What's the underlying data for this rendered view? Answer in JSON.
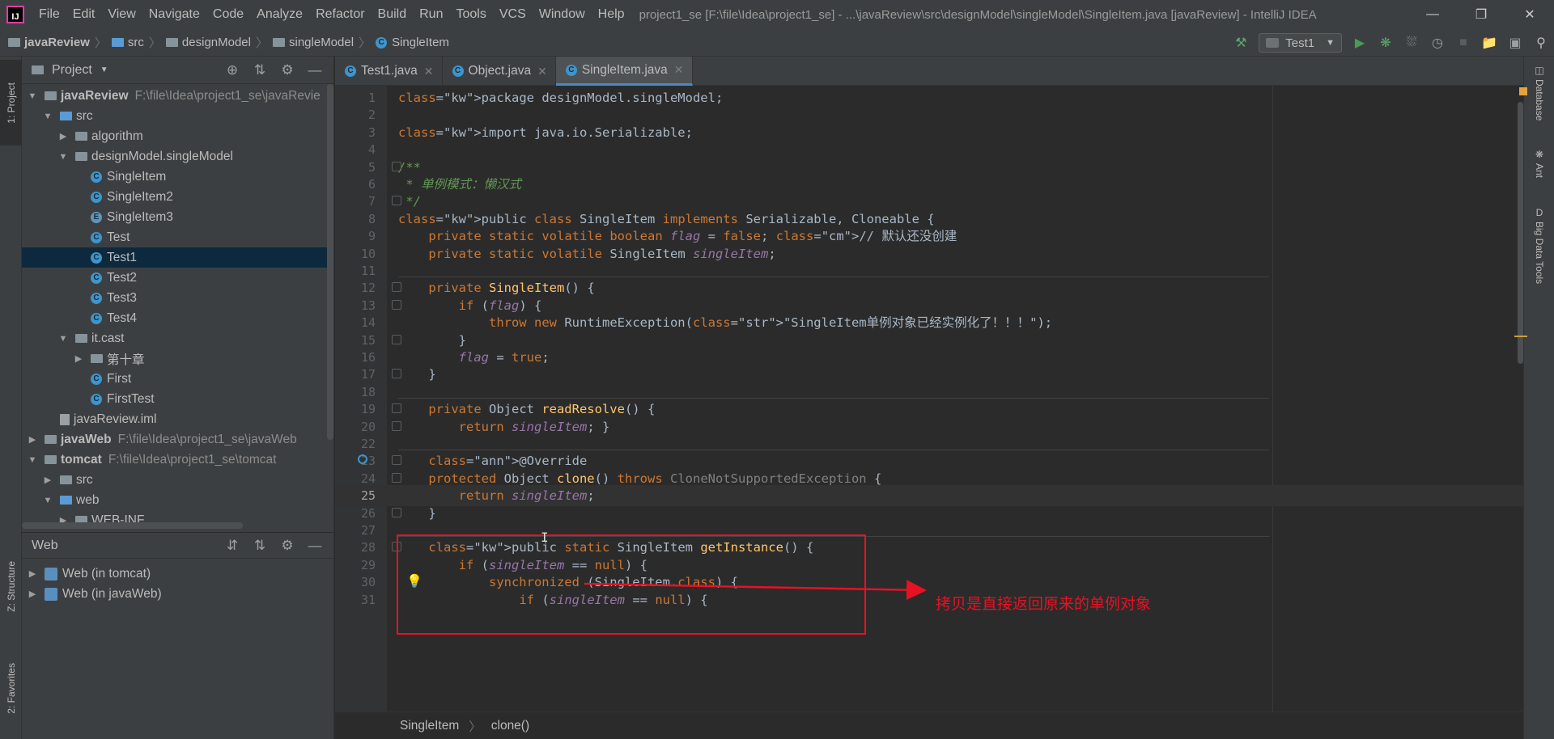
{
  "window": {
    "title": "project1_se [F:\\file\\Idea\\project1_se] - ...\\javaReview\\src\\designModel\\singleModel\\SingleItem.java [javaReview] - IntelliJ IDEA",
    "logo": "IJ",
    "controls": [
      "minimize-icon",
      "restore-icon",
      "close-icon"
    ]
  },
  "menu": [
    "File",
    "Edit",
    "View",
    "Navigate",
    "Code",
    "Analyze",
    "Refactor",
    "Build",
    "Run",
    "Tools",
    "VCS",
    "Window",
    "Help"
  ],
  "nav": {
    "crumbs": [
      "javaReview",
      "src",
      "designModel",
      "singleModel",
      "SingleItem"
    ],
    "run_config": "Test1"
  },
  "left_stripe": {
    "project_tab": "1: Project",
    "structure_tab": "Z: Structure",
    "favorites_tab": "2: Favorites"
  },
  "project_panel": {
    "title": "Project",
    "tree": [
      {
        "label": "javaReview",
        "path": "F:\\file\\Idea\\project1_se\\javaRevie",
        "type": "module",
        "expanded": true
      },
      {
        "label": "src",
        "type": "folder-src",
        "expanded": true
      },
      {
        "label": "algorithm",
        "type": "package",
        "expanded": false
      },
      {
        "label": "designModel.singleModel",
        "type": "package",
        "expanded": true
      },
      {
        "label": "SingleItem",
        "type": "class"
      },
      {
        "label": "SingleItem2",
        "type": "class"
      },
      {
        "label": "SingleItem3",
        "type": "enum"
      },
      {
        "label": "Test",
        "type": "class-run"
      },
      {
        "label": "Test1",
        "type": "class-run",
        "selected": true
      },
      {
        "label": "Test2",
        "type": "class-run"
      },
      {
        "label": "Test3",
        "type": "class-run"
      },
      {
        "label": "Test4",
        "type": "class-run"
      },
      {
        "label": "it.cast",
        "type": "package",
        "expanded": true
      },
      {
        "label": "第十章",
        "type": "package",
        "expanded": false
      },
      {
        "label": "First",
        "type": "class-run"
      },
      {
        "label": "FirstTest",
        "type": "class-run"
      },
      {
        "label": "javaReview.iml",
        "type": "file"
      },
      {
        "label": "javaWeb",
        "path": "F:\\file\\Idea\\project1_se\\javaWeb",
        "type": "module",
        "expanded": false
      },
      {
        "label": "tomcat",
        "path": "F:\\file\\Idea\\project1_se\\tomcat",
        "type": "module",
        "expanded": true
      },
      {
        "label": "src",
        "type": "folder",
        "expanded": false
      },
      {
        "label": "web",
        "type": "folder-web",
        "expanded": true
      },
      {
        "label": "WEB-INF",
        "type": "folder",
        "expanded": false
      }
    ]
  },
  "web_panel": {
    "title": "Web",
    "items": [
      "Web (in tomcat)",
      "Web (in javaWeb)"
    ]
  },
  "tabs": [
    {
      "label": "Test1.java",
      "active": false
    },
    {
      "label": "Object.java",
      "active": false
    },
    {
      "label": "SingleItem.java",
      "active": true
    }
  ],
  "code_lines": [
    {
      "n": "1",
      "t": "package designModel.singleModel;"
    },
    {
      "n": "2",
      "t": ""
    },
    {
      "n": "3",
      "t": "import java.io.Serializable;"
    },
    {
      "n": "4",
      "t": ""
    },
    {
      "n": "5",
      "t": "/**"
    },
    {
      "n": "6",
      "t": " * 单例模式：懒汉式"
    },
    {
      "n": "7",
      "t": " */"
    },
    {
      "n": "8",
      "t": "public class SingleItem implements Serializable, Cloneable {"
    },
    {
      "n": "9",
      "t": "    private static volatile boolean flag = false; // 默认还没创建"
    },
    {
      "n": "10",
      "t": "    private static volatile SingleItem singleItem;"
    },
    {
      "n": "11",
      "t": ""
    },
    {
      "n": "12",
      "t": "    private SingleItem() {"
    },
    {
      "n": "13",
      "t": "        if (flag) {"
    },
    {
      "n": "14",
      "t": "            throw new RuntimeException(\"SingleItem单例对象已经实例化了！！！\");"
    },
    {
      "n": "15",
      "t": "        }"
    },
    {
      "n": "16",
      "t": "        flag = true;"
    },
    {
      "n": "17",
      "t": "    }"
    },
    {
      "n": "18",
      "t": ""
    },
    {
      "n": "19",
      "t": "    private Object readResolve() {"
    },
    {
      "n": "20",
      "t": "        return singleItem; }"
    },
    {
      "n": "22",
      "t": ""
    },
    {
      "n": "23",
      "t": "    @Override"
    },
    {
      "n": "24",
      "t": "    protected Object clone() throws CloneNotSupportedException {"
    },
    {
      "n": "25",
      "t": "        return singleItem;"
    },
    {
      "n": "26",
      "t": "    }"
    },
    {
      "n": "27",
      "t": ""
    },
    {
      "n": "28",
      "t": "    public static SingleItem getInstance() {"
    },
    {
      "n": "29",
      "t": "        if (singleItem == null) {"
    },
    {
      "n": "30",
      "t": "            synchronized (SingleItem.class) {"
    },
    {
      "n": "31",
      "t": "                if (singleItem == null) {"
    }
  ],
  "editor_breadcrumbs": [
    "SingleItem",
    "clone()"
  ],
  "right_stripe": [
    "Database",
    "Ant",
    "Big Data Tools"
  ],
  "annotation": {
    "text": "拷贝是直接返回原来的单例对象",
    "color": "#e81123"
  },
  "colors": {
    "keyword": "#cc7832",
    "doc_comment": "#629755",
    "string": "#6a8759",
    "field": "#9876aa",
    "method": "#ffc66d",
    "annotation": "#bbb529",
    "selection": "#0d293e",
    "accent": "#4a88c7"
  }
}
